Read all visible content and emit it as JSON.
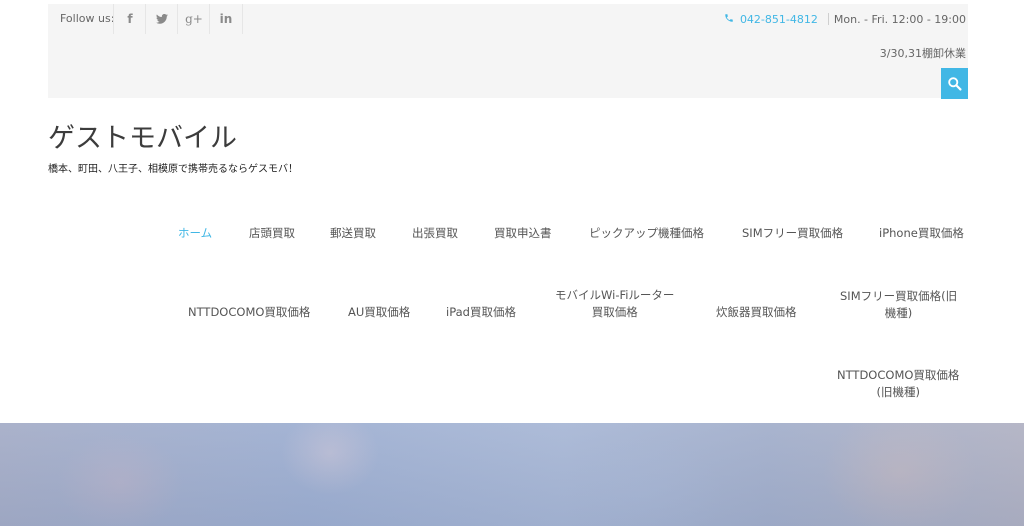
{
  "topbar": {
    "follow_label": "Follow us:",
    "social": [
      {
        "icon": "facebook-icon",
        "glyph": "f"
      },
      {
        "icon": "twitter-icon",
        "glyph": "🐦"
      },
      {
        "icon": "google-plus-icon",
        "glyph": "g+"
      },
      {
        "icon": "linkedin-icon",
        "glyph": "in"
      }
    ],
    "phone": "042-851-4812",
    "hours": "Mon. - Fri. 12:00 - 19:00",
    "notice": "3/30,31棚卸休業",
    "accent_color": "#41b7e5"
  },
  "header": {
    "site_title": "ゲストモバイル",
    "tagline": "橋本、町田、八王子、相模原で携帯売るならゲスモバ！"
  },
  "nav": {
    "items": [
      {
        "label": "ホーム",
        "active": true
      },
      {
        "label": "店頭買取"
      },
      {
        "label": "郵送買取"
      },
      {
        "label": "出張買取"
      },
      {
        "label": "買取申込書"
      },
      {
        "label": "ピックアップ機種価格"
      },
      {
        "label": "SIMフリー買取価格"
      },
      {
        "label": "iPhone買取価格"
      },
      {
        "label": "NTTDOCOMO買取価格"
      },
      {
        "label": "AU買取価格"
      },
      {
        "label": "iPad買取価格"
      },
      {
        "label": "モバイルWi-Fiルーター\n買取価格"
      },
      {
        "label": "炊飯器買取価格"
      },
      {
        "label": "SIMフリー買取価格(旧\n機種)"
      },
      {
        "label": "NTTDOCOMO買取価格\n(旧機種)"
      }
    ]
  }
}
